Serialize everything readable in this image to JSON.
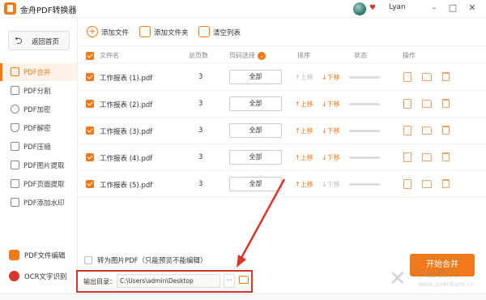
{
  "app": {
    "title": "金舟PDF转换器",
    "user_name": "Lyan"
  },
  "window_controls": [
    "–",
    "□",
    "✕"
  ],
  "sidebar": {
    "back_label": "返回首页",
    "items": [
      {
        "label": "PDF合并",
        "active": true
      },
      {
        "label": "PDF分割",
        "active": false
      },
      {
        "label": "PDF加密",
        "active": false
      },
      {
        "label": "PDF解密",
        "active": false
      },
      {
        "label": "PDF压缩",
        "active": false
      },
      {
        "label": "PDF图片提取",
        "active": false
      },
      {
        "label": "PDF页面提取",
        "active": false
      },
      {
        "label": "PDF添加水印",
        "active": false
      }
    ],
    "tools": [
      {
        "label": "PDF文件编辑",
        "color": "#f07a1a"
      },
      {
        "label": "OCR文字识别",
        "color": "#d9362b"
      }
    ]
  },
  "toolbar": {
    "add_file": "添加文件",
    "add_folder": "添加文件夹",
    "clear_list": "清空列表"
  },
  "table": {
    "headers": {
      "name": "文件名",
      "pages": "总页数",
      "range": "页码选择",
      "order": "排序",
      "status": "状态",
      "actions": "操作"
    },
    "move_up": "上移",
    "move_down": "下移",
    "rows": [
      {
        "name": "工作报表 (1).pdf",
        "pages": "3",
        "range": "全部",
        "checked": true,
        "status": 0
      },
      {
        "name": "工作报表 (2).pdf",
        "pages": "3",
        "range": "全部",
        "checked": true,
        "status": 0
      },
      {
        "name": "工作报表 (3).pdf",
        "pages": "3",
        "range": "全部",
        "checked": true,
        "status": 0
      },
      {
        "name": "工作报表 (4).pdf",
        "pages": "3",
        "range": "全部",
        "checked": true,
        "status": 0
      },
      {
        "name": "工作报表 (5).pdf",
        "pages": "3",
        "range": "全部",
        "checked": true,
        "status": 0
      }
    ]
  },
  "bottom": {
    "img_pdf_label": "转为图片PDF（只能预览不能编辑）",
    "img_pdf_checked": false,
    "output_label": "输出目录：",
    "output_path": "C:\\Users\\admin\\Desktop",
    "browse_label": "···",
    "start_label": "开始合并"
  },
  "watermark": {
    "main": "下载银行",
    "sub": "www.downbank.cn"
  },
  "colors": {
    "accent": "#f07a1a",
    "highlight": "#d9362b"
  }
}
